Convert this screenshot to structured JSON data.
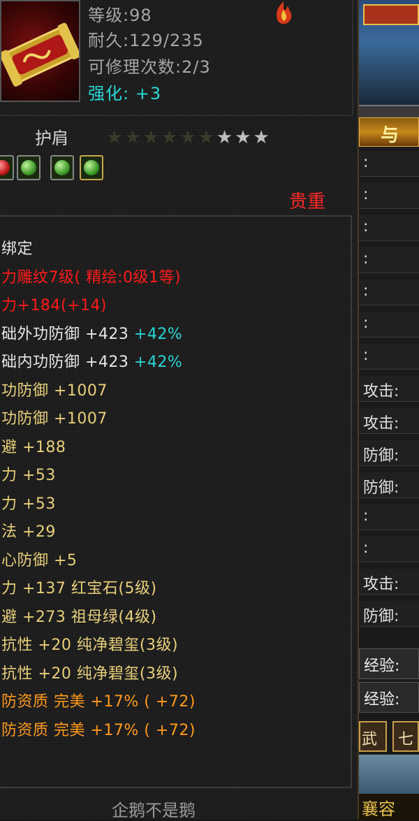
{
  "item": {
    "level": "等级:98",
    "durability": "耐久:129/235",
    "repair": "可修理次数:2/3",
    "enhance_label": "强化:",
    "enhance_value": " +3",
    "type": "护肩",
    "rarity": "贵重",
    "stars_filled": 6,
    "stars_total": 9,
    "gem_slots": [
      "red-gem",
      "green-gem",
      "green-gem",
      "green-gem"
    ]
  },
  "attributes": [
    {
      "text": "绑定",
      "color": "white"
    },
    {
      "text": "力雕纹7级( 精绘:0级1等)",
      "color": "red"
    },
    {
      "text": "力+184(+14)",
      "color": "red"
    },
    {
      "text": "础外功防御 +423",
      "extra": " +42%",
      "color": "white"
    },
    {
      "text": "础内功防御 +423",
      "extra": " +42%",
      "color": "white"
    },
    {
      "text": "功防御 +1007",
      "color": "yellow"
    },
    {
      "text": "功防御 +1007",
      "color": "yellow"
    },
    {
      "text": "避 +188",
      "color": "yellow"
    },
    {
      "text": "力 +53",
      "color": "yellow"
    },
    {
      "text": "力 +53",
      "color": "yellow"
    },
    {
      "text": "法 +29",
      "color": "yellow"
    },
    {
      "text": "心防御 +5",
      "color": "yellow"
    },
    {
      "text": "力 +137 红宝石(5级)",
      "color": "yellow"
    },
    {
      "text": "避 +273 祖母绿(4级)",
      "color": "yellow"
    },
    {
      "text": "抗性 +20 纯净碧玺(3级)",
      "color": "yellow"
    },
    {
      "text": "抗性 +20 纯净碧玺(3级)",
      "color": "yellow"
    },
    {
      "text": "防资质 完美 +17% ( +72)",
      "color": "orange"
    },
    {
      "text": "防资质 完美 +17% ( +72)",
      "color": "orange"
    }
  ],
  "footer_name": "企鹅不是鹅",
  "right_panel": {
    "banner": "与",
    "rows": [
      ":",
      ":",
      ":",
      ":",
      ":",
      ":",
      ":",
      "攻击:",
      "攻击:",
      "防御:",
      "防御:",
      ":",
      ":",
      "攻击:",
      "防御:"
    ],
    "exp_rows": [
      "经验:",
      "经验:"
    ],
    "tab1": "武",
    "tab2": "七",
    "bottom": "襄容"
  }
}
